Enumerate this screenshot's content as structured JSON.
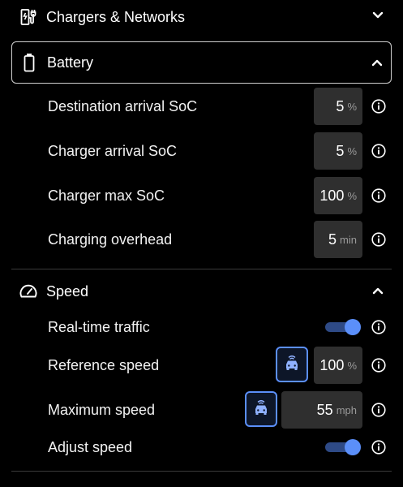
{
  "sections": {
    "chargers": {
      "title": "Chargers & Networks",
      "icon": "ev-charger-icon",
      "expanded": false
    },
    "battery": {
      "title": "Battery",
      "icon": "battery-icon",
      "expanded": true
    },
    "speed": {
      "title": "Speed",
      "icon": "speedometer-icon",
      "expanded": true
    }
  },
  "battery_settings": [
    {
      "label": "Destination arrival SoC",
      "value": "5",
      "unit": "%"
    },
    {
      "label": "Charger arrival SoC",
      "value": "5",
      "unit": "%"
    },
    {
      "label": "Charger max SoC",
      "value": "100",
      "unit": "%"
    },
    {
      "label": "Charging overhead",
      "value": "5",
      "unit": "min"
    }
  ],
  "speed_settings": {
    "realtime_traffic": {
      "label": "Real-time traffic",
      "enabled": true
    },
    "reference_speed": {
      "label": "Reference speed",
      "value": "100",
      "unit": "%",
      "icon": "car-signal-icon"
    },
    "maximum_speed": {
      "label": "Maximum speed",
      "value": "55",
      "unit": "mph",
      "icon": "car-signal-icon"
    },
    "adjust_speed": {
      "label": "Adjust speed",
      "enabled": true
    }
  },
  "colors": {
    "accent": "#5b8ff9",
    "toggle_track": "#2e4a86",
    "input_bg": "#2f2f2f",
    "background": "#000000"
  }
}
